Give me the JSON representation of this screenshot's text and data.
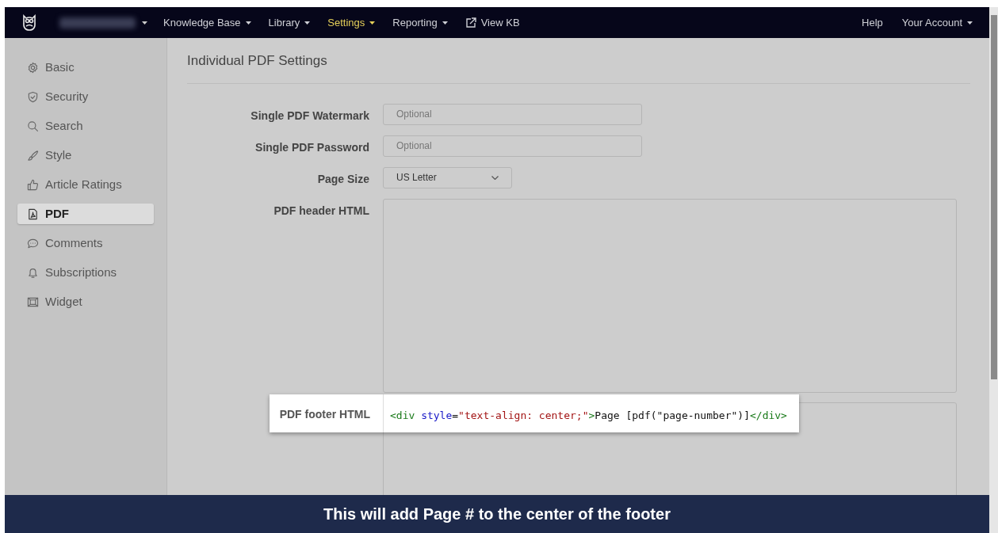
{
  "navbar": {
    "items": [
      {
        "label": "Knowledge Base",
        "selected": false,
        "dropdown": true,
        "kind": "menu"
      },
      {
        "label": "Library",
        "selected": false,
        "dropdown": true,
        "kind": "menu"
      },
      {
        "label": "Settings",
        "selected": true,
        "dropdown": true,
        "kind": "menu"
      },
      {
        "label": "Reporting",
        "selected": false,
        "dropdown": true,
        "kind": "menu"
      },
      {
        "label": "View KB",
        "selected": false,
        "dropdown": false,
        "kind": "external"
      }
    ],
    "right_items": [
      {
        "label": "Help",
        "dropdown": false
      },
      {
        "label": "Your Account",
        "dropdown": true
      }
    ]
  },
  "sidebar": {
    "items": [
      {
        "label": "Basic",
        "selected": false
      },
      {
        "label": "Security",
        "selected": false
      },
      {
        "label": "Search",
        "selected": false
      },
      {
        "label": "Style",
        "selected": false
      },
      {
        "label": "Article Ratings",
        "selected": false
      },
      {
        "label": "PDF",
        "selected": true
      },
      {
        "label": "Comments",
        "selected": false
      },
      {
        "label": "Subscriptions",
        "selected": false
      },
      {
        "label": "Widget",
        "selected": false
      }
    ]
  },
  "main": {
    "title": "Individual PDF Settings",
    "fields": [
      {
        "label": "Single PDF Watermark",
        "kind": "text",
        "placeholder": "Optional"
      },
      {
        "label": "Single PDF Password",
        "kind": "text",
        "placeholder": "Optional"
      },
      {
        "label": "Page Size",
        "kind": "select",
        "value": "US Letter"
      },
      {
        "label": "PDF header HTML",
        "kind": "textarea"
      }
    ],
    "footer_field": {
      "label": "PDF footer HTML",
      "code": [
        {
          "kind": "tag",
          "text": "<div"
        },
        {
          "kind": "attr",
          "text": " style"
        },
        {
          "kind": "plain",
          "text": "="
        },
        {
          "kind": "string",
          "text": "\"text-align: center;\""
        },
        {
          "kind": "tag",
          "text": ">"
        },
        {
          "kind": "plain",
          "text": "Page [pdf(\"page-number\")]"
        },
        {
          "kind": "tag",
          "text": "</div>"
        }
      ]
    }
  },
  "caption": "This will add Page # to the center of the footer"
}
